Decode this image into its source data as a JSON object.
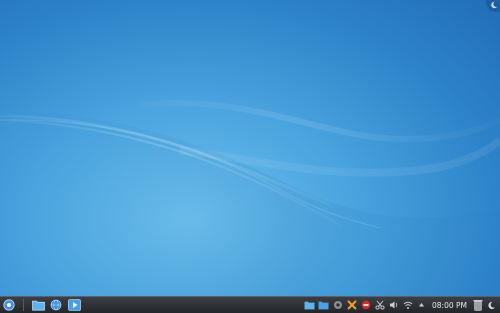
{
  "desktop": {
    "background_color": "#3b93d6"
  },
  "panel": {
    "launchers": [
      {
        "name": "application-launcher",
        "icon": "kde-launcher-icon"
      },
      {
        "name": "file-manager",
        "icon": "folder-icon"
      },
      {
        "name": "web-browser",
        "icon": "globe-icon"
      },
      {
        "name": "media-player",
        "icon": "play-icon"
      }
    ],
    "tray": {
      "items": [
        "folder-icon",
        "folder-icon",
        "gear-icon",
        "tools-icon",
        "alert-icon",
        "scissors-icon",
        "volume-icon",
        "wifi-icon",
        "arrow-up-icon"
      ],
      "clock": "08:00 PM"
    },
    "trash_icon": "trash-icon",
    "corner_icon": "moon-icon"
  }
}
